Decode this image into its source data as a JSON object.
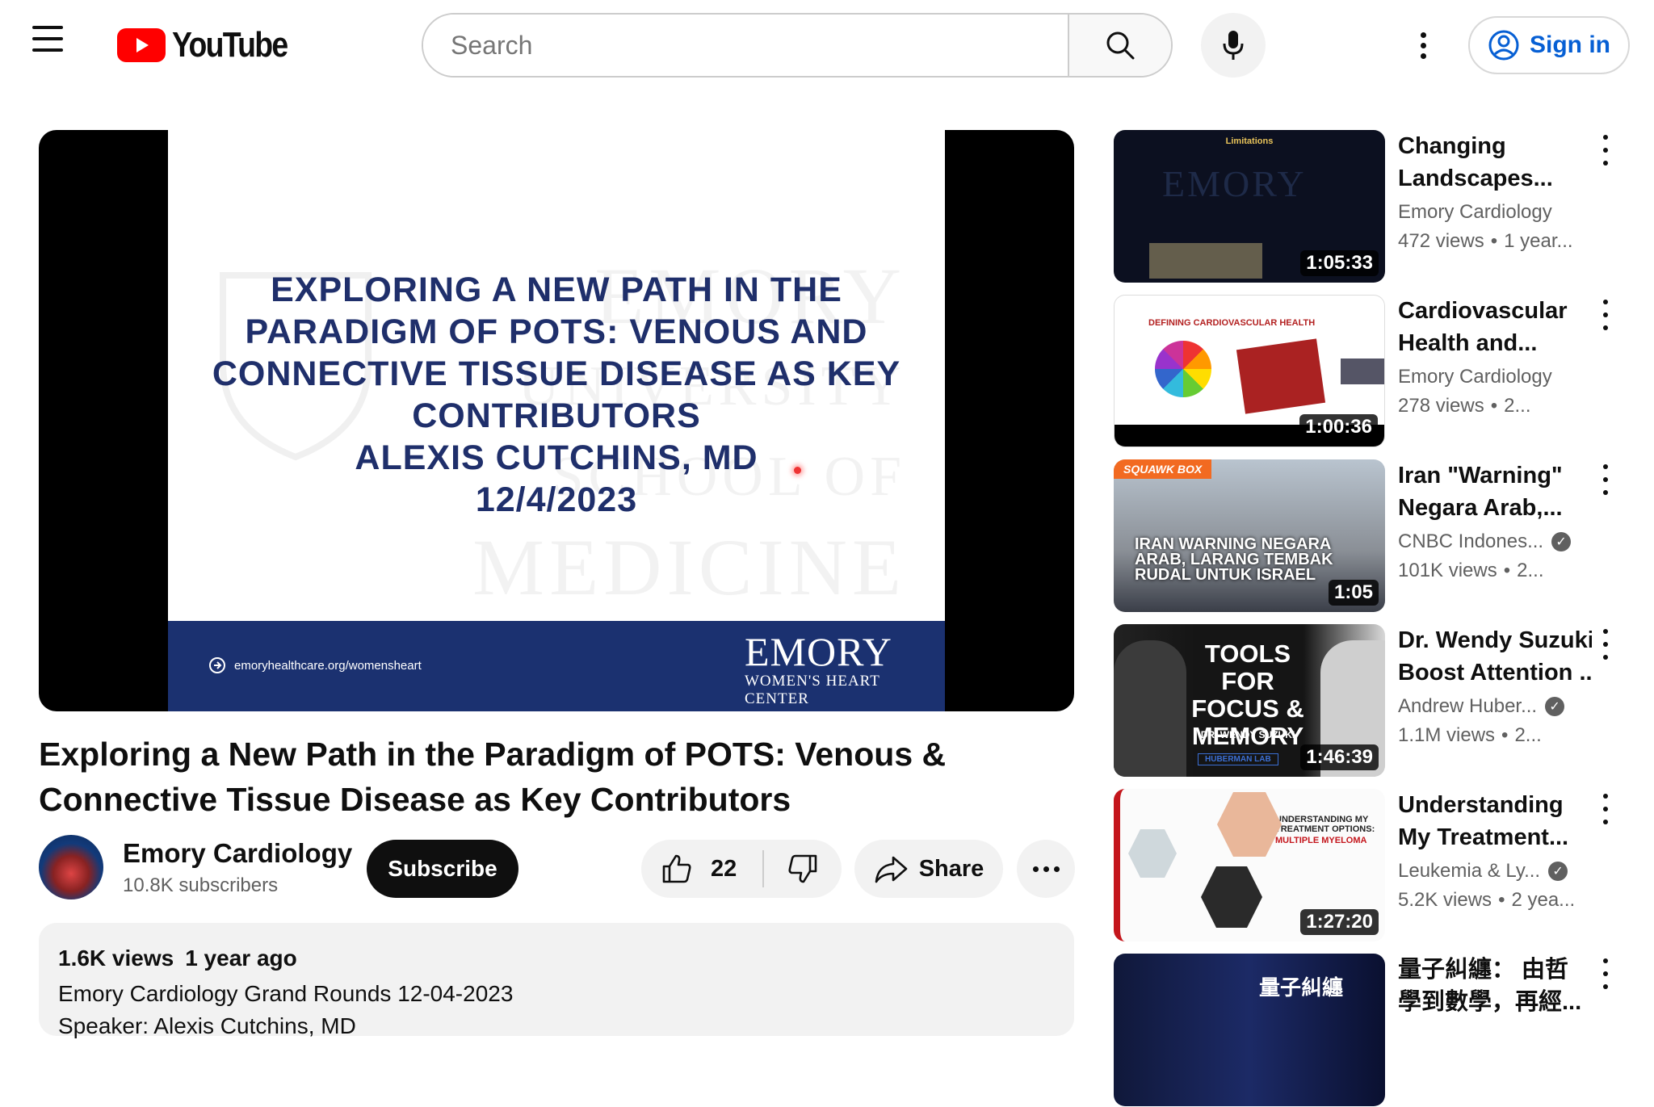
{
  "header": {
    "logo_text": "YouTube",
    "search_placeholder": "Search",
    "signin_label": "Sign in"
  },
  "player": {
    "slide_title_lines": [
      "EXPLORING A NEW PATH IN THE",
      "PARADIGM OF POTS: VENOUS AND",
      "CONNECTIVE TISSUE DISEASE AS KEY",
      "CONTRIBUTORS",
      "ALEXIS CUTCHINS, MD",
      "12/4/2023"
    ],
    "slide_url": "emoryhealthcare.org/womensheart",
    "slide_logo_main": "EMORY",
    "slide_logo_line1": "WOMEN'S HEART",
    "slide_logo_line2": "CENTER",
    "watermark_lines": [
      "EMORY",
      "UNIVERSITY",
      "SCHOOL OF",
      "MEDICINE"
    ]
  },
  "video": {
    "title": "Exploring a New Path in the Paradigm of POTS: Venous & Connective Tissue Disease as Key Contributors",
    "channel": "Emory Cardiology",
    "subscribers": "10.8K subscribers",
    "subscribe_label": "Subscribe",
    "likes": "22",
    "share_label": "Share",
    "views": "1.6K views",
    "age": "1 year ago",
    "description_lines": [
      "Emory Cardiology Grand Rounds 12-04-2023",
      "Speaker: Alexis Cutchins, MD"
    ]
  },
  "sidebar": {
    "items": [
      {
        "title_lines": [
          "Changing",
          "Landscapes..."
        ],
        "channel": "Emory Cardiology",
        "verified": false,
        "views": "472 views",
        "age": "1 year...",
        "duration": "1:05:33",
        "thumb_text": "Limitations"
      },
      {
        "title_lines": [
          "Cardiovascular",
          "Health and..."
        ],
        "channel": "Emory Cardiology",
        "verified": false,
        "views": "278 views",
        "age": "2...",
        "duration": "1:00:36",
        "thumb_text": "DEFINING CARDIOVASCULAR HEALTH"
      },
      {
        "title_lines": [
          "Iran \"Warning\"",
          "Negara Arab,..."
        ],
        "channel": "CNBC Indones...",
        "verified": true,
        "views": "101K views",
        "age": "2...",
        "duration": "1:05",
        "thumb_text": "IRAN WARNING NEGARA ARAB, LARANG TEMBAK RUDAL UNTUK ISRAEL",
        "thumb_badge": "SQUAWK BOX"
      },
      {
        "title_lines": [
          "Dr. Wendy Suzuki:",
          "Boost Attention ..."
        ],
        "channel": "Andrew Huber...",
        "verified": true,
        "views": "1.1M views",
        "age": "2...",
        "duration": "1:46:39",
        "thumb_text": "TOOLS FOR FOCUS & MEMORY",
        "thumb_sub": "DR. WENDY SUZUKI",
        "thumb_badge": "HUBERMAN LAB"
      },
      {
        "title_lines": [
          "Understanding",
          "My Treatment..."
        ],
        "channel": "Leukemia & Ly...",
        "verified": true,
        "views": "5.2K views",
        "age": "2 yea...",
        "duration": "1:27:20",
        "thumb_text": "UNDERSTANDING MY TREATMENT OPTIONS:",
        "thumb_sub": "MULTIPLE MYELOMA"
      },
      {
        "title_lines": [
          "量子糾纏： 由哲",
          "學到數學，再經..."
        ],
        "channel": "",
        "verified": false,
        "views": "",
        "age": "",
        "duration": "",
        "thumb_text": "量子糾纏"
      }
    ]
  },
  "colors": {
    "youtube_red": "#ff0000",
    "slide_navy": "#1b3170",
    "link_blue": "#065fd4"
  }
}
